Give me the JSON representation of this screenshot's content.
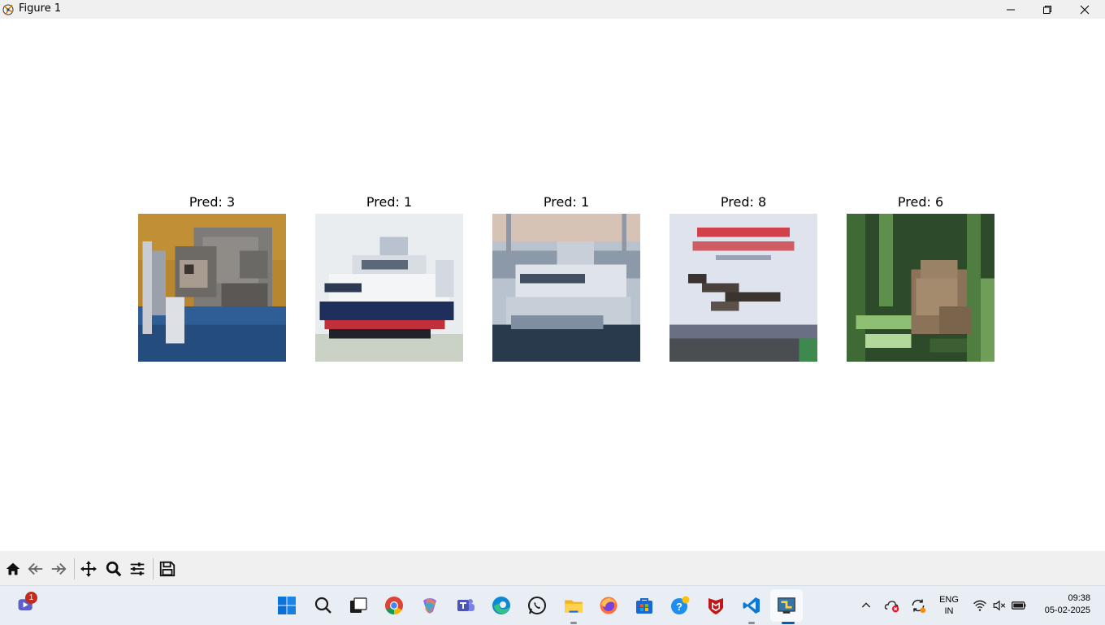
{
  "window": {
    "title": "Figure 1",
    "minimize_icon": "minimize-icon",
    "maximize_icon": "restore-icon",
    "close_icon": "close-icon"
  },
  "figure": {
    "subplots": [
      {
        "title": "Pred: 3",
        "image": "cat"
      },
      {
        "title": "Pred: 1",
        "image": "ship"
      },
      {
        "title": "Pred: 1",
        "image": "ship"
      },
      {
        "title": "Pred: 8",
        "image": "airplane"
      },
      {
        "title": "Pred: 6",
        "image": "frog"
      }
    ]
  },
  "toolbar": {
    "buttons": [
      "home-icon",
      "back-icon",
      "forward-icon",
      "pan-icon",
      "zoom-icon",
      "configure-subplots-icon",
      "save-icon"
    ]
  },
  "taskbar": {
    "apps": [
      "teams-chat-icon",
      "start-icon",
      "search-icon",
      "task-view-icon",
      "chrome-icon",
      "copilot-icon",
      "teams-icon",
      "edge-icon",
      "whatsapp-icon",
      "file-explorer-icon",
      "firefox-icon",
      "store-icon",
      "help-icon",
      "mcafee-icon",
      "vscode-icon",
      "python-icon"
    ],
    "notification_badge": "1",
    "tray": {
      "language_line1": "ENG",
      "language_line2": "IN",
      "time": "09:38",
      "date": "05-02-2025"
    }
  }
}
